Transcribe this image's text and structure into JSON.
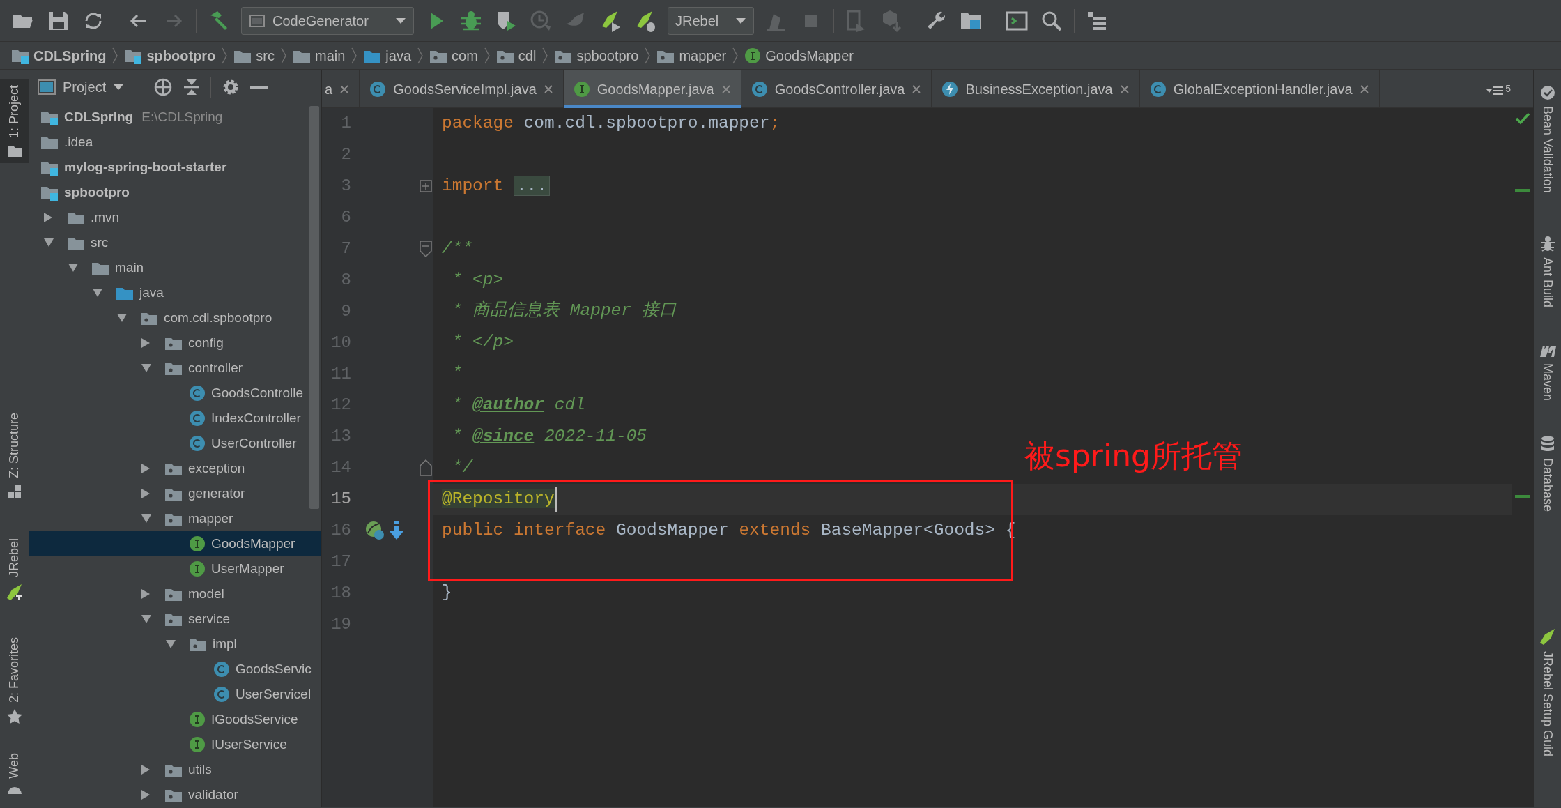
{
  "toolbar": {
    "run_configuration": "CodeGenerator",
    "jrebel_configuration": "JRebel"
  },
  "breadcrumb": [
    {
      "label": "CDLSpring",
      "kind": "module"
    },
    {
      "label": "spbootpro",
      "kind": "module"
    },
    {
      "label": "src",
      "kind": "folder"
    },
    {
      "label": "main",
      "kind": "folder"
    },
    {
      "label": "java",
      "kind": "source_root"
    },
    {
      "label": "com",
      "kind": "package"
    },
    {
      "label": "cdl",
      "kind": "package"
    },
    {
      "label": "spbootpro",
      "kind": "package"
    },
    {
      "label": "mapper",
      "kind": "package"
    },
    {
      "label": "GoodsMapper",
      "kind": "interface"
    }
  ],
  "left_stripe": [
    {
      "label": "1: Project",
      "kind": "project",
      "selected": true
    },
    {
      "label": "Z: Structure",
      "kind": "structure",
      "selected": false
    },
    {
      "label": "JRebel",
      "kind": "jrebel",
      "selected": false
    },
    {
      "label": "2: Favorites",
      "kind": "favorites",
      "selected": false
    },
    {
      "label": "Web",
      "kind": "web",
      "selected": false
    }
  ],
  "project_panel": {
    "title": "Project",
    "tree": [
      {
        "label": "CDLSpring",
        "path": "E:\\CDLSpring",
        "kind": "module",
        "selected": false
      },
      {
        "label": ".idea",
        "kind": "folder",
        "selected": false
      },
      {
        "label": "mylog-spring-boot-starter",
        "kind": "module",
        "selected": false
      },
      {
        "label": "spbootpro",
        "kind": "module",
        "selected": false,
        "children": [
          {
            "label": ".mvn",
            "kind": "folder",
            "expanded": false,
            "selected": false
          },
          {
            "label": "src",
            "kind": "folder",
            "expanded": true,
            "selected": false,
            "children": [
              {
                "label": "main",
                "kind": "folder",
                "expanded": true,
                "selected": false,
                "children": [
                  {
                    "label": "java",
                    "kind": "source_root",
                    "expanded": true,
                    "selected": false,
                    "children": [
                      {
                        "label": "com.cdl.spbootpro",
                        "kind": "package",
                        "expanded": true,
                        "selected": false,
                        "children": [
                          {
                            "label": "config",
                            "kind": "package",
                            "expanded": false,
                            "selected": false
                          },
                          {
                            "label": "controller",
                            "kind": "package",
                            "expanded": true,
                            "selected": false,
                            "children": [
                              {
                                "label": "GoodsControlle",
                                "kind": "class",
                                "selected": false
                              },
                              {
                                "label": "IndexController",
                                "kind": "class",
                                "selected": false
                              },
                              {
                                "label": "UserController",
                                "kind": "class",
                                "selected": false
                              }
                            ]
                          },
                          {
                            "label": "exception",
                            "kind": "package",
                            "expanded": false,
                            "selected": false
                          },
                          {
                            "label": "generator",
                            "kind": "package",
                            "expanded": false,
                            "selected": false
                          },
                          {
                            "label": "mapper",
                            "kind": "package",
                            "expanded": true,
                            "selected": false,
                            "children": [
                              {
                                "label": "GoodsMapper",
                                "kind": "interface",
                                "selected": true
                              },
                              {
                                "label": "UserMapper",
                                "kind": "interface",
                                "selected": false
                              }
                            ]
                          },
                          {
                            "label": "model",
                            "kind": "package",
                            "expanded": false,
                            "selected": false
                          },
                          {
                            "label": "service",
                            "kind": "package",
                            "expanded": true,
                            "selected": false,
                            "children": [
                              {
                                "label": "impl",
                                "kind": "package",
                                "expanded": true,
                                "selected": false,
                                "children": [
                                  {
                                    "label": "GoodsServic",
                                    "kind": "class",
                                    "selected": false
                                  },
                                  {
                                    "label": "UserServiceI",
                                    "kind": "class",
                                    "selected": false
                                  }
                                ]
                              },
                              {
                                "label": "IGoodsService",
                                "kind": "interface",
                                "selected": false
                              },
                              {
                                "label": "IUserService",
                                "kind": "interface",
                                "selected": false
                              }
                            ]
                          },
                          {
                            "label": "utils",
                            "kind": "package",
                            "expanded": false,
                            "selected": false
                          },
                          {
                            "label": "validator",
                            "kind": "package",
                            "expanded": false,
                            "selected": false
                          }
                        ]
                      }
                    ]
                  }
                ]
              }
            ]
          }
        ]
      }
    ]
  },
  "editor_tabs": {
    "tabs": [
      {
        "label": "a",
        "kind": "partial",
        "selected": false
      },
      {
        "label": "GoodsServiceImpl.java",
        "kind": "class",
        "selected": false
      },
      {
        "label": "GoodsMapper.java",
        "kind": "interface",
        "selected": true
      },
      {
        "label": "GoodsController.java",
        "kind": "class",
        "selected": false
      },
      {
        "label": "BusinessException.java",
        "kind": "exception",
        "selected": false
      },
      {
        "label": "GlobalExceptionHandler.java",
        "kind": "class",
        "selected": false
      }
    ],
    "hidden_count": "5"
  },
  "code": {
    "lines": [
      {
        "number": "1",
        "current": false,
        "tokens": [
          {
            "text": "package",
            "kind": "keyword"
          },
          {
            "text": " com.cdl.spbootpro.mapper",
            "kind": "plain"
          },
          {
            "text": ";",
            "kind": "keyword"
          }
        ]
      },
      {
        "number": "2",
        "current": false
      },
      {
        "number": "3",
        "current": false,
        "fold": {
          "kind": "collapsed"
        },
        "tokens": [
          {
            "text": "import ",
            "kind": "keyword"
          },
          {
            "text": "...",
            "kind": "folded"
          }
        ]
      },
      {
        "number": "6",
        "current": false
      },
      {
        "number": "7",
        "current": false,
        "fold": {
          "kind": "start"
        },
        "tokens": [
          {
            "text": "/**",
            "kind": "doc"
          }
        ]
      },
      {
        "number": "8",
        "current": false,
        "tokens": [
          {
            "text": " * <p>",
            "kind": "doc"
          }
        ]
      },
      {
        "number": "9",
        "current": false,
        "tokens": [
          {
            "text": " * 商品信息表 Mapper 接口",
            "kind": "doc"
          }
        ]
      },
      {
        "number": "10",
        "current": false,
        "tokens": [
          {
            "text": " * </p>",
            "kind": "doc"
          }
        ]
      },
      {
        "number": "11",
        "current": false,
        "tokens": [
          {
            "text": " *",
            "kind": "doc"
          }
        ]
      },
      {
        "number": "12",
        "current": false,
        "tokens": [
          {
            "text": " * ",
            "kind": "doc"
          },
          {
            "text": "@author",
            "kind": "doc_tag"
          },
          {
            "text": " cdl",
            "kind": "doc"
          }
        ]
      },
      {
        "number": "13",
        "current": false,
        "tokens": [
          {
            "text": " * ",
            "kind": "doc"
          },
          {
            "text": "@since",
            "kind": "doc_tag"
          },
          {
            "text": " 2022-11-05",
            "kind": "doc"
          }
        ]
      },
      {
        "number": "14",
        "current": false,
        "fold": {
          "kind": "end"
        },
        "tokens": [
          {
            "text": " */",
            "kind": "doc"
          }
        ]
      },
      {
        "number": "15",
        "current": true,
        "tokens": [
          {
            "text": "@Repository",
            "kind": "annotation"
          }
        ]
      },
      {
        "number": "16",
        "current": false,
        "gutter_icons": true,
        "tokens": [
          {
            "text": "public interface",
            "kind": "keyword"
          },
          {
            "text": " GoodsMapper ",
            "kind": "plain"
          },
          {
            "text": "extends",
            "kind": "keyword"
          },
          {
            "text": " BaseMapper<Goods> {",
            "kind": "plain"
          }
        ]
      },
      {
        "number": "17",
        "current": false
      },
      {
        "number": "18",
        "current": false,
        "tokens": [
          {
            "text": "}",
            "kind": "plain"
          }
        ]
      },
      {
        "number": "19",
        "current": false
      }
    ]
  },
  "annotation": {
    "text": "被spring所托管"
  },
  "right_stripe": [
    {
      "label": "Bean Validation",
      "kind": "bean_validation"
    },
    {
      "label": "Ant Build",
      "kind": "ant"
    },
    {
      "label": "Maven",
      "kind": "maven"
    },
    {
      "label": "Database",
      "kind": "database"
    },
    {
      "label": "JRebel Setup Guid",
      "kind": "jrebel"
    }
  ]
}
